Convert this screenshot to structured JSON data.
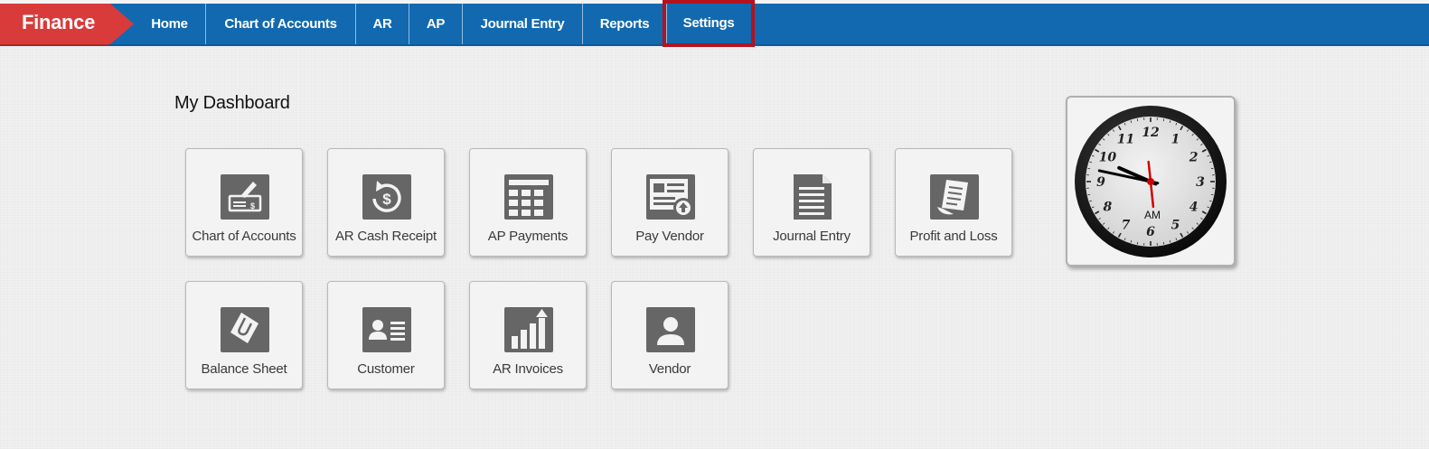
{
  "navbar": {
    "brand": "Finance",
    "items": [
      {
        "label": "Home"
      },
      {
        "label": "Chart of Accounts"
      },
      {
        "label": "AR"
      },
      {
        "label": "AP"
      },
      {
        "label": "Journal Entry"
      },
      {
        "label": "Reports"
      },
      {
        "label": "Settings",
        "active": true
      }
    ],
    "colors": {
      "bar": "#1269b0",
      "brand": "#d93b3b",
      "active_outline": "#b3121f"
    }
  },
  "dashboard": {
    "title": "My Dashboard",
    "tiles": [
      {
        "label": "Chart of Accounts",
        "icon": "check-icon"
      },
      {
        "label": "AR Cash Receipt",
        "icon": "dollar-refresh-icon"
      },
      {
        "label": "AP Payments",
        "icon": "grid-calculator-icon"
      },
      {
        "label": "Pay Vendor",
        "icon": "document-upload-icon"
      },
      {
        "label": "Journal Entry",
        "icon": "document-lines-icon"
      },
      {
        "label": "Profit and Loss",
        "icon": "receipt-icon"
      },
      {
        "label": "Balance Sheet",
        "icon": "paperclip-card-icon"
      },
      {
        "label": "Customer",
        "icon": "contact-card-icon"
      },
      {
        "label": "AR Invoices",
        "icon": "bar-chart-growth-icon"
      },
      {
        "label": "Vendor",
        "icon": "person-icon"
      }
    ]
  },
  "clock": {
    "numerals": [
      "12",
      "1",
      "2",
      "3",
      "4",
      "5",
      "6",
      "7",
      "8",
      "9",
      "10",
      "11"
    ],
    "period": "AM",
    "hands": {
      "hour": 9,
      "minute": 47,
      "second": 59
    }
  }
}
